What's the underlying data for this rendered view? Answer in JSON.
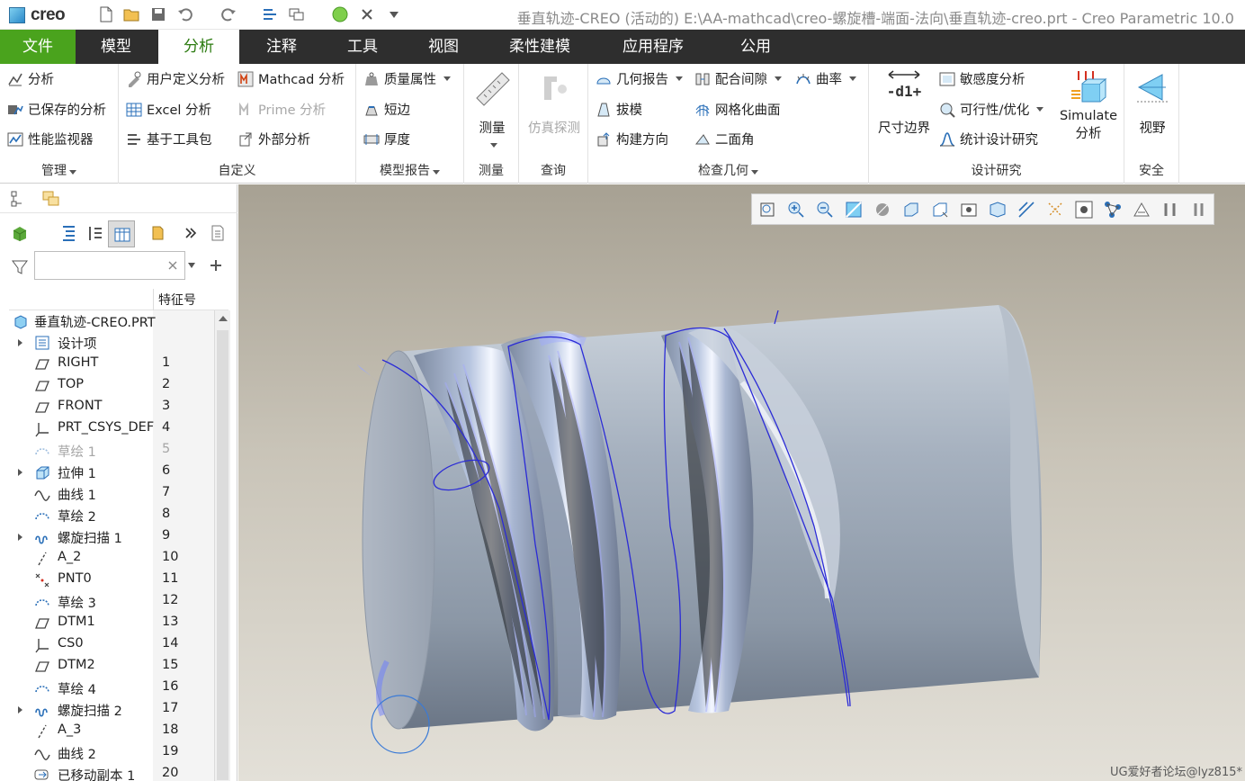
{
  "app": {
    "logo_text": "creo",
    "window_title": "垂直轨迹-CREO (活动的) E:\\AA-mathcad\\creo-螺旋槽-端面-法向\\垂直轨迹-creo.prt - Creo Parametric 10.0"
  },
  "tabs": [
    {
      "label": "文件"
    },
    {
      "label": "模型"
    },
    {
      "label": "分析"
    },
    {
      "label": "注释"
    },
    {
      "label": "工具"
    },
    {
      "label": "视图"
    },
    {
      "label": "柔性建模"
    },
    {
      "label": "应用程序"
    },
    {
      "label": "公用"
    }
  ],
  "ribbon": {
    "manage": {
      "label": "管理",
      "items": [
        "分析",
        "已保存的分析",
        "性能监视器"
      ]
    },
    "custom": {
      "label": "自定义",
      "items": [
        "用户定义分析",
        "Excel 分析",
        "基于工具包",
        "Mathcad 分析",
        "Prime 分析",
        "外部分析"
      ]
    },
    "model_report": {
      "label": "模型报告",
      "items": [
        "质量属性",
        "短边",
        "厚度"
      ]
    },
    "measure": {
      "label": "测量",
      "button": "测量"
    },
    "query": {
      "label": "查询",
      "button": "仿真探测"
    },
    "inspect": {
      "label": "检查几何",
      "items": [
        "几何报告",
        "拔模",
        "构建方向",
        "配合间隙",
        "网格化曲面",
        "二面角",
        "曲率"
      ]
    },
    "design_study": {
      "label": "设计研究",
      "dim_boundary": "尺寸边界",
      "items": [
        "敏感度分析",
        "可行性/优化",
        "统计设计研究"
      ],
      "simulate_line1": "Simulate",
      "simulate_line2": "分析"
    },
    "safety": {
      "label": "安全",
      "button": "视野"
    }
  },
  "left_panel": {
    "filter_placeholder": "",
    "column_header": "特征号",
    "tree": [
      {
        "name": "垂直轨迹-CREO.PRT",
        "num": "",
        "icon": "part-icon",
        "expandable": false,
        "dim": false
      },
      {
        "name": "设计项",
        "num": "",
        "icon": "design-items-icon",
        "expandable": true,
        "dim": false
      },
      {
        "name": "RIGHT",
        "num": "1",
        "icon": "datum-plane-icon",
        "expandable": false,
        "dim": false
      },
      {
        "name": "TOP",
        "num": "2",
        "icon": "datum-plane-icon",
        "expandable": false,
        "dim": false
      },
      {
        "name": "FRONT",
        "num": "3",
        "icon": "datum-plane-icon",
        "expandable": false,
        "dim": false
      },
      {
        "name": "PRT_CSYS_DEF",
        "num": "4",
        "icon": "csys-icon",
        "expandable": false,
        "dim": false
      },
      {
        "name": "草绘 1",
        "num": "5",
        "icon": "sketch-icon",
        "expandable": false,
        "dim": true
      },
      {
        "name": "拉伸 1",
        "num": "6",
        "icon": "extrude-icon",
        "expandable": true,
        "dim": false
      },
      {
        "name": "曲线 1",
        "num": "7",
        "icon": "curve-icon",
        "expandable": false,
        "dim": false
      },
      {
        "name": "草绘 2",
        "num": "8",
        "icon": "sketch-icon",
        "expandable": false,
        "dim": false
      },
      {
        "name": "螺旋扫描 1",
        "num": "9",
        "icon": "helical-sweep-icon",
        "expandable": true,
        "dim": false
      },
      {
        "name": "A_2",
        "num": "10",
        "icon": "axis-icon",
        "expandable": false,
        "dim": false
      },
      {
        "name": "PNT0",
        "num": "11",
        "icon": "point-icon",
        "expandable": false,
        "dim": false
      },
      {
        "name": "草绘 3",
        "num": "12",
        "icon": "sketch-icon",
        "expandable": false,
        "dim": false
      },
      {
        "name": "DTM1",
        "num": "13",
        "icon": "datum-plane-icon",
        "expandable": false,
        "dim": false
      },
      {
        "name": "CS0",
        "num": "14",
        "icon": "csys-icon",
        "expandable": false,
        "dim": false
      },
      {
        "name": "DTM2",
        "num": "15",
        "icon": "datum-plane-icon",
        "expandable": false,
        "dim": false
      },
      {
        "name": "草绘 4",
        "num": "16",
        "icon": "sketch-icon",
        "expandable": false,
        "dim": false
      },
      {
        "name": "螺旋扫描 2",
        "num": "17",
        "icon": "helical-sweep-icon",
        "expandable": true,
        "dim": false
      },
      {
        "name": "A_3",
        "num": "18",
        "icon": "axis-icon",
        "expandable": false,
        "dim": false
      },
      {
        "name": "曲线 2",
        "num": "19",
        "icon": "curve-icon",
        "expandable": false,
        "dim": false
      },
      {
        "name": "已移动副本 1",
        "num": "20",
        "icon": "moved-copy-icon",
        "expandable": false,
        "dim": false
      }
    ]
  },
  "viewport": {
    "toolbar_icons": [
      "refit-icon",
      "zoom-in-icon",
      "zoom-out-icon",
      "repaint-icon",
      "display-style-icon",
      "standard-orientation-icon",
      "saved-orientations-icon",
      "view-manager-icon",
      "perspective-icon",
      "section-icon",
      "datum-display-icon",
      "annotation-display-icon",
      "spin-center-icon",
      "skeleton-icon",
      "hidden-line-icon",
      "pause-icon",
      "flip-icon"
    ],
    "watermark": "UG爱好者论坛@lyz815*"
  },
  "colors": {
    "tab_active_text": "#2a7a0e",
    "file_tab": "#4aa31d",
    "tabbar": "#2e2e2e",
    "curve": "#2b2bd6"
  }
}
